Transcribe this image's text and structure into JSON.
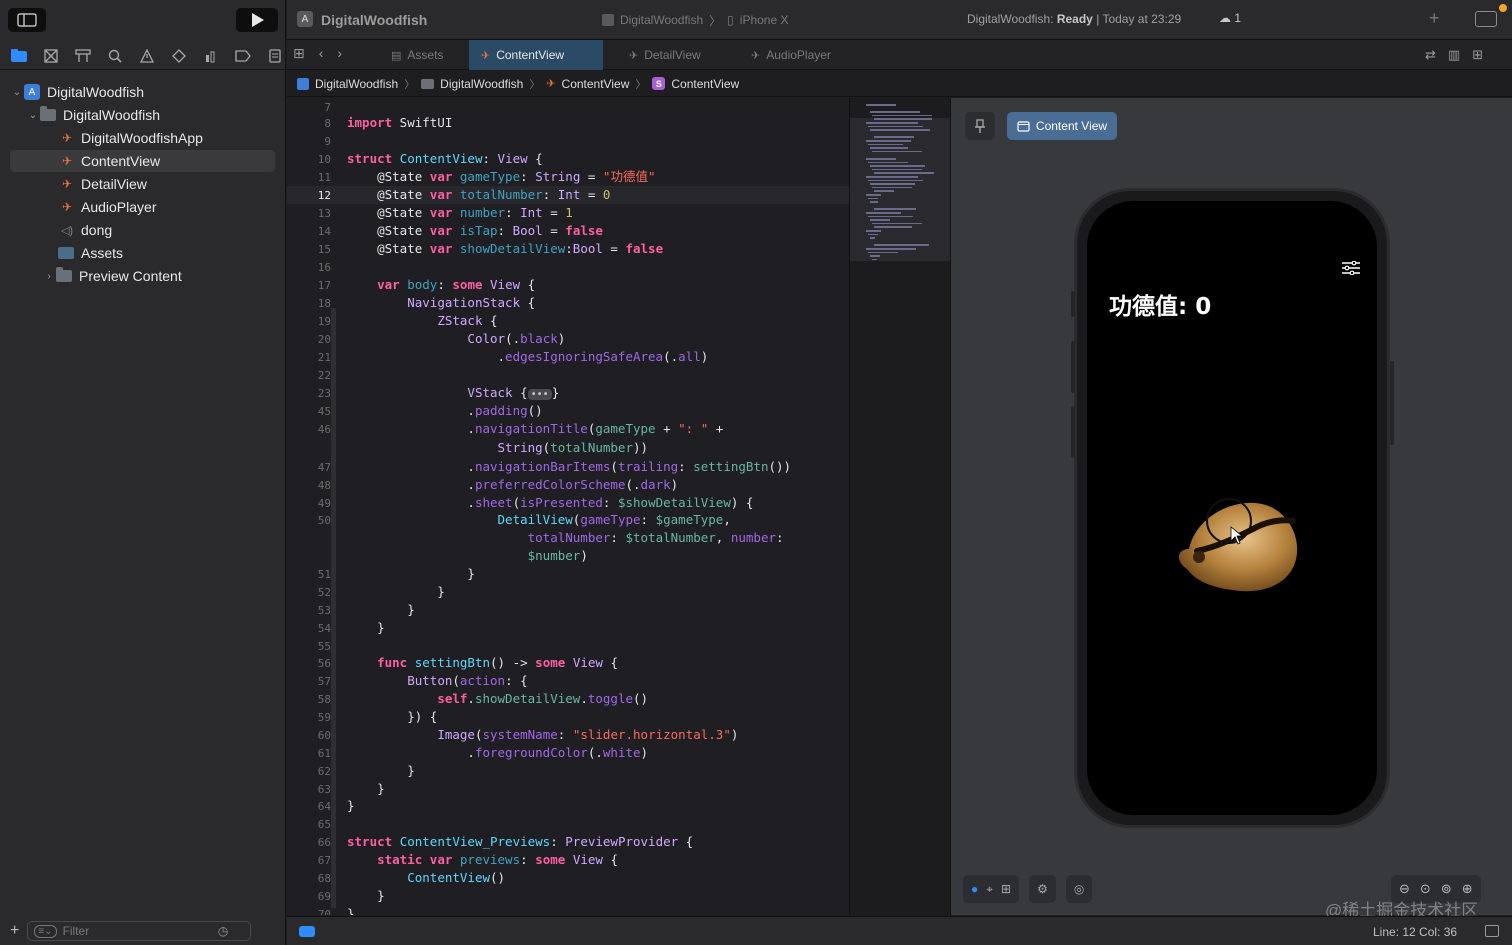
{
  "sidebar": {
    "tree": [
      {
        "label": "DigitalWoodfish",
        "kind": "project",
        "level": 0,
        "expanded": true
      },
      {
        "label": "DigitalWoodfish",
        "kind": "folder",
        "level": 1,
        "expanded": true
      },
      {
        "label": "DigitalWoodfishApp",
        "kind": "swift",
        "level": 2
      },
      {
        "label": "ContentView",
        "kind": "swift",
        "level": 2,
        "selected": true
      },
      {
        "label": "DetailView",
        "kind": "swift",
        "level": 2
      },
      {
        "label": "AudioPlayer",
        "kind": "swift",
        "level": 2
      },
      {
        "label": "dong",
        "kind": "audio",
        "level": 2
      },
      {
        "label": "Assets",
        "kind": "assets",
        "level": 2
      },
      {
        "label": "Preview Content",
        "kind": "folder",
        "level": 2,
        "expanded": false
      }
    ],
    "filter_placeholder": "Filter"
  },
  "toolbar": {
    "app_title": "DigitalWoodfish",
    "scheme": "DigitalWoodfish",
    "device": "iPhone X",
    "status_app": "DigitalWoodfish:",
    "status_state": "Ready",
    "status_time": "| Today at 23:29",
    "cloud_count": "1"
  },
  "tabs": [
    {
      "label": "Assets",
      "active": false
    },
    {
      "label": "ContentView",
      "active": true
    },
    {
      "label": "DetailView",
      "active": false
    },
    {
      "label": "AudioPlayer",
      "active": false
    }
  ],
  "breadcrumb": [
    "DigitalWoodfish",
    "DigitalWoodfish",
    "ContentView",
    "ContentView"
  ],
  "editor": {
    "line_numbers": [
      "7",
      "8",
      "9",
      "10",
      "11",
      "12",
      "13",
      "14",
      "15",
      "16",
      "17",
      "18",
      "19",
      "20",
      "21",
      "22",
      "23",
      "45",
      "46",
      "",
      "47",
      "48",
      "49",
      "50",
      "",
      "",
      "51",
      "52",
      "53",
      "54",
      "55",
      "56",
      "57",
      "58",
      "59",
      "60",
      "61",
      "62",
      "63",
      "64",
      "65",
      "66",
      "67",
      "68",
      "69",
      "70"
    ],
    "current_line": "12"
  },
  "canvas": {
    "preview_label": "Content View",
    "nav_title": "功德值: 0",
    "watermark": "@稀土掘金技术社区"
  },
  "statusbar": {
    "line_col": "Line: 12  Col: 36"
  }
}
